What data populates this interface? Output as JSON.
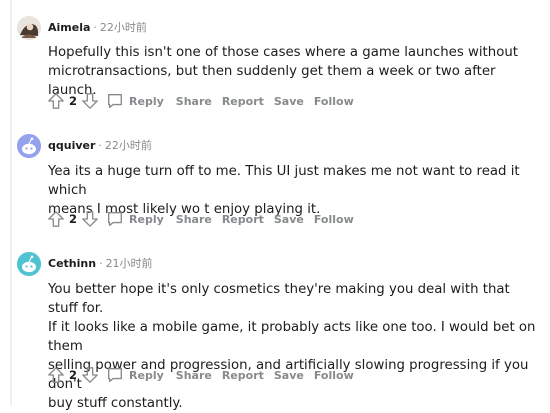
{
  "comments": [
    {
      "author": "Aimela",
      "time": "22小时前",
      "avatar_color": "#e9e4de",
      "lines": [
        "Hopefully this isn't one of those cases where a game launches without",
        "microtransactions, but then suddenly get them a week or two after launch."
      ],
      "score": "2"
    },
    {
      "author": "qquiver",
      "time": "22小时前",
      "avatar_color": "#94a2ee",
      "lines": [
        "Yea its a huge turn off to me. This UI just makes me not want to read it which",
        "means I most likely wo t enjoy playing it."
      ],
      "score": "2"
    },
    {
      "author": "Cethinn",
      "time": "21小时前",
      "avatar_color": "#4fc3d2",
      "lines": [
        "You better hope it's only cosmetics they're making you deal with that stuff for.",
        "If it looks like a mobile game, it probably acts like one too. I would bet on them",
        "selling power and progression, and artificially slowing progressing if you don't",
        "buy stuff constantly."
      ],
      "score": "2"
    }
  ],
  "actions": {
    "reply": "Reply",
    "share": "Share",
    "report": "Report",
    "save": "Save",
    "follow": "Follow"
  },
  "icons": {
    "upvote": "upvote-arrow-icon",
    "downvote": "downvote-arrow-icon",
    "reply": "speech-bubble-icon"
  }
}
